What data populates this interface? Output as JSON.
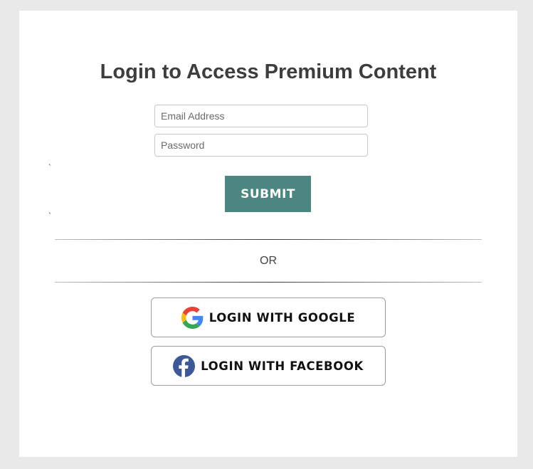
{
  "page": {
    "title": "Login to Access Premium Content"
  },
  "form": {
    "email_placeholder": "Email Address",
    "email_value": "",
    "password_placeholder": "Password",
    "password_value": "",
    "stray_char_1": "`",
    "stray_char_2": "`",
    "submit_label": "SUBMIT"
  },
  "separator": {
    "text": "OR"
  },
  "social": {
    "google_label": "LOGIN WITH GOOGLE",
    "google_icon": "google-logo-icon",
    "facebook_label": "LOGIN WITH FACEBOOK",
    "facebook_icon": "facebook-logo-icon"
  },
  "colors": {
    "background": "#e9e9e9",
    "card": "#ffffff",
    "title": "#3d3d3d",
    "submit_button": "#4b8681",
    "facebook_blue": "#3b5998"
  }
}
